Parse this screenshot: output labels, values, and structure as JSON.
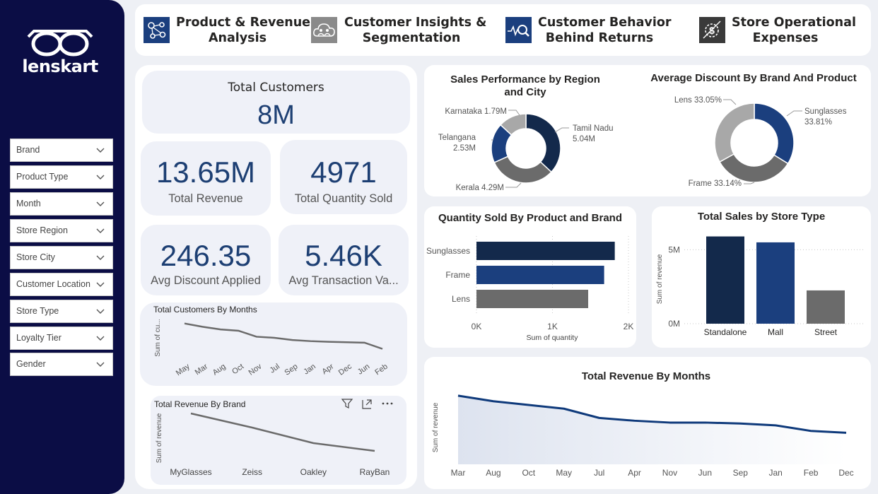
{
  "brand": {
    "name": "lenskart"
  },
  "colors": {
    "navy": "#0b0d45",
    "dark_blue": "#13294b",
    "blue": "#1b3f7e",
    "gray": "#6b6b6b",
    "light_gray": "#a8a8a8",
    "accent_line": "#0f3a7b"
  },
  "filters": [
    "Brand",
    "Product Type",
    "Month",
    "Store Region",
    "Store City",
    "Customer Location",
    "Store Type",
    "Loyalty Tier",
    "Gender"
  ],
  "nav": [
    {
      "line1": "Product & Revenue",
      "line2": "Analysis",
      "icon": "network-nodes-icon"
    },
    {
      "line1": "Customer Insights &",
      "line2": "Segmentation",
      "icon": "cloud-people-icon"
    },
    {
      "line1": "Customer Behavior",
      "line2": "Behind Returns",
      "icon": "search-analytics-icon"
    },
    {
      "line1": "Store Operational",
      "line2": "Expenses",
      "icon": "money-gear-icon"
    }
  ],
  "kpis": {
    "total_customers": {
      "value": "8M",
      "label": "Total Customers"
    },
    "total_revenue": {
      "value": "13.65M",
      "label": "Total Revenue"
    },
    "total_quantity": {
      "value": "4971",
      "label": "Total Quantity Sold"
    },
    "avg_discount": {
      "value": "246.35",
      "label": "Avg Discount Applied"
    },
    "avg_transaction": {
      "value": "5.46K",
      "label": "Avg Transaction Va..."
    }
  },
  "chart_data": [
    {
      "id": "customers_by_months",
      "type": "line",
      "title": "Total Customers By Months",
      "ylabel": "Sum of cu...",
      "categories": [
        "May",
        "Mar",
        "Aug",
        "Oct",
        "Nov",
        "Jul",
        "Sep",
        "Jan",
        "Apr",
        "Dec",
        "Jun",
        "Feb"
      ],
      "values": [
        705,
        690,
        678,
        672,
        645,
        640,
        630,
        625,
        622,
        620,
        618,
        590
      ],
      "ylim": [
        560,
        720
      ]
    },
    {
      "id": "revenue_by_brand",
      "type": "line",
      "title": "Total Revenue By Brand",
      "ylabel": "Sum of revenue",
      "categories": [
        "MyGlasses",
        "Zeiss",
        "Oakley",
        "RayBan"
      ],
      "values": [
        3.7,
        3.5,
        3.28,
        3.17
      ],
      "ylim": [
        3.0,
        3.8
      ]
    },
    {
      "id": "sales_by_region",
      "type": "pie",
      "title": "Sales Performance by Region and City",
      "labels": [
        "Tamil Nadu",
        "Kerala",
        "Telangana",
        "Karnataka"
      ],
      "label_texts": [
        "5.04M",
        "4.29M",
        "2.53M",
        "1.79M"
      ],
      "values": [
        5.04,
        4.29,
        2.53,
        1.79
      ],
      "colors": [
        "#13294b",
        "#6b6b6b",
        "#1b3f7e",
        "#a8a8a8"
      ]
    },
    {
      "id": "avg_discount_brand_product",
      "type": "pie",
      "title": "Average Discount By Brand And Product",
      "labels": [
        "Sunglasses",
        "Frame",
        "Lens"
      ],
      "label_texts": [
        "33.81%",
        "33.14%",
        "33.05%"
      ],
      "values": [
        33.81,
        33.14,
        33.05
      ],
      "colors": [
        "#1b3f7e",
        "#6b6b6b",
        "#a8a8a8"
      ]
    },
    {
      "id": "quantity_by_product",
      "type": "bar",
      "orientation": "horizontal",
      "title": "Quantity Sold By Product and Brand",
      "xlabel": "Sum of quantity",
      "categories": [
        "Sunglasses",
        "Frame",
        "Lens"
      ],
      "values": [
        1820,
        1680,
        1470
      ],
      "xlim": [
        0,
        2000
      ],
      "ticks": [
        "0K",
        "1K",
        "2K"
      ],
      "colors": [
        "#13294b",
        "#1b3f7e",
        "#6b6b6b"
      ]
    },
    {
      "id": "sales_by_store_type",
      "type": "bar",
      "title": "Total Sales by Store Type",
      "ylabel": "Sum of revenue",
      "categories": [
        "Standalone",
        "Mall",
        "Street"
      ],
      "values": [
        5.9,
        5.5,
        2.25
      ],
      "ylim": [
        0,
        6.5
      ],
      "ticks": [
        "0M",
        "5M"
      ],
      "colors": [
        "#13294b",
        "#1b3f7e",
        "#6b6b6b"
      ]
    },
    {
      "id": "revenue_by_months",
      "type": "area",
      "title": "Total Revenue By Months",
      "ylabel": "Sum of revenue",
      "categories": [
        "Mar",
        "Aug",
        "Oct",
        "May",
        "Jul",
        "Apr",
        "Nov",
        "Jun",
        "Sep",
        "Jan",
        "Feb",
        "Dec"
      ],
      "values": [
        1.34,
        1.28,
        1.24,
        1.2,
        1.1,
        1.07,
        1.05,
        1.05,
        1.04,
        1.02,
        0.96,
        0.94
      ],
      "ylim": [
        0.6,
        1.4
      ]
    }
  ]
}
